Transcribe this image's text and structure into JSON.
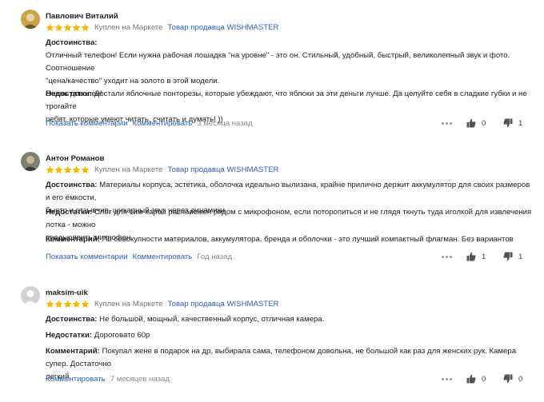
{
  "reviews": [
    {
      "author": "Павлович Виталий",
      "bought": "Куплен на Маркете",
      "seller": "Товар продавца WISHMASTER",
      "rating": 5,
      "advantages_label": "Достоинства:",
      "advantages_lines": [
        "Отличный телефон! Если нужна рабочая лошадка \"на уровне\" - это он. Стильный, удобный, быстрый, великолепный звук и фото. Соотношение",
        "\"цена/качество\" уходит на золото в этой модели.",
        "Очень доволен!"
      ],
      "disadvantages_label": "Недостатки:",
      "disadvantages_lines": [
        "Достали яблочные понторезы, которые убеждают, что яблоки за эти деньги лучше. Да целуйте себя в сладкие губки и не трогайте",
        "ребят, которые умеют читать, считать и думать! ))"
      ],
      "show_comments": "Показать комментарии",
      "comment": "Комментировать",
      "time": "3 месяца назад",
      "likes": "0",
      "dislikes": "1"
    },
    {
      "author": "Антон Романов",
      "bought": "Куплен на Маркете",
      "seller": "Товар продавца WISHMASTER",
      "rating": 5,
      "advantages_label": "Достоинства:",
      "advantages_lines": [
        "Материалы корпуса, эстетика, оболочка идеально вылизана, крайне прилично держит аккумулятор для своих размеров и его ёмкости,",
        "быстр и отзывчив, шикарный звук через динамики"
      ],
      "disadvantages_label": "Недостатки:",
      "disadvantages_lines": [
        "Слот для сим-карты расположен рядом с микрофоном, если поторопиться и не глядя ткнуть туда иголкой для извлечения лотка - можно",
        "продырявить микрофон."
      ],
      "comment_label": "Комментарий:",
      "comment_lines": [
        "По совокупности материалов, аккумулятора, бренда и оболочки - это лучший компактный флагман. Без вариантов"
      ],
      "show_comments": "Показать комментарии",
      "comment": "Комментировать",
      "time": "Год назад",
      "likes": "1",
      "dislikes": "1"
    },
    {
      "author": "maksim-uik",
      "bought": "Куплен на Маркете",
      "seller": "Товар продавца WISHMASTER",
      "rating": 5,
      "advantages_label": "Достоинства:",
      "advantages_lines": [
        "Не большой, мощный, качественный корпус, отличная камера."
      ],
      "disadvantages_label": "Недостатки:",
      "disadvantages_lines": [
        "Дороговато 60р"
      ],
      "comment_label": "Комментарий:",
      "comment_lines": [
        "Покупал жене в подарок на др, выбирала сама, телефоном довольна, не большой как раз для женских рук. Камера супер. Достаточно",
        "легкий."
      ],
      "comment": "Комментировать",
      "time": "7 месяцев назад",
      "likes": "0",
      "dislikes": "0"
    }
  ],
  "colors": {
    "star": "#f5b800",
    "link": "#2b5fc2"
  },
  "icons": {
    "like": "thumb-up-icon",
    "dislike": "thumb-down-icon",
    "more": "more-dots-icon"
  }
}
